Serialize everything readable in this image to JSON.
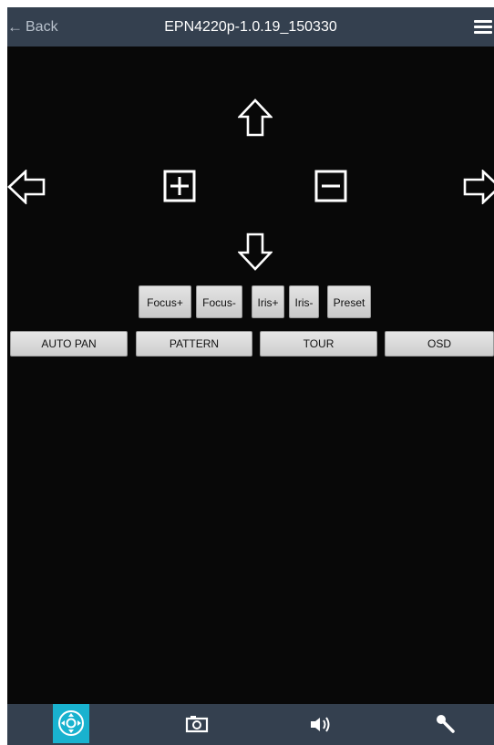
{
  "header": {
    "back_arrow": "←",
    "back_label": "Back",
    "title": "EPN4220p-1.0.19_150330",
    "menu_icon": "hamburger-menu-icon"
  },
  "ptz": {
    "up_icon": "arrow-up-icon",
    "down_icon": "arrow-down-icon",
    "left_icon": "arrow-left-icon",
    "right_icon": "arrow-right-icon",
    "zoom_in_icon": "zoom-in-plus-icon",
    "zoom_out_icon": "zoom-out-minus-icon"
  },
  "lens_buttons": [
    "Focus+",
    "Focus-",
    "Iris+",
    "Iris-",
    "Preset"
  ],
  "mode_buttons": [
    "AUTO PAN",
    "PATTERN",
    "TOUR",
    "OSD"
  ],
  "bottom_nav": {
    "items": [
      "ptz-control-icon",
      "snapshot-camera-icon",
      "speaker-audio-icon",
      "microphone-icon"
    ],
    "active": "ptz-control-icon"
  },
  "colors": {
    "header_bg": "#34404f",
    "body_bg": "#080808",
    "accent": "#19b2cf",
    "button_bg": "#d6d6d6"
  }
}
